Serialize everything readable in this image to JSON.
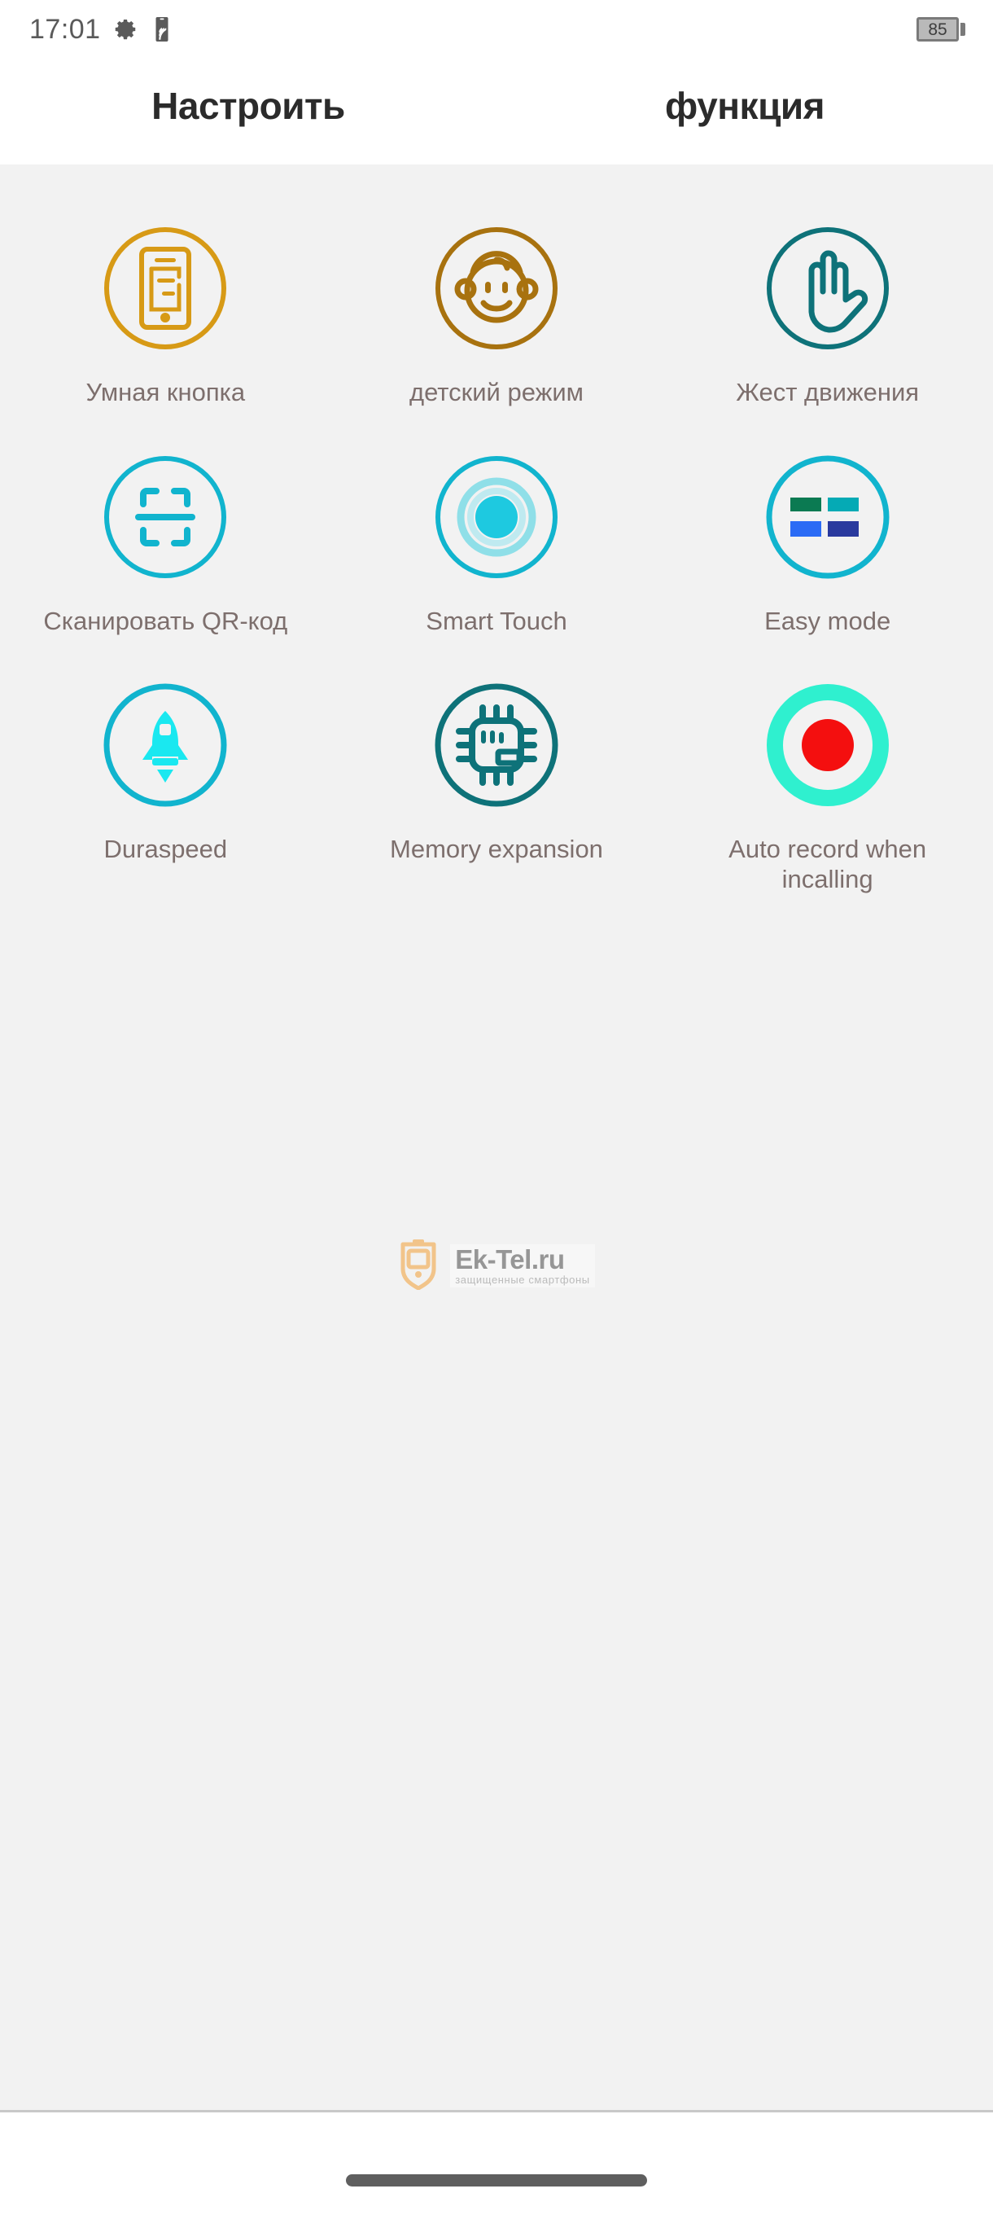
{
  "status_bar": {
    "clock": "17:01",
    "icons": [
      {
        "name": "settings-gear-icon",
        "label": "settings"
      },
      {
        "name": "nfc-tag-icon",
        "label": "nfc"
      }
    ],
    "battery": {
      "level_text": "85"
    }
  },
  "header": {
    "title_left": "Настроить",
    "title_right": "функция"
  },
  "colors": {
    "background": "#f2f2f2",
    "surface": "#ffffff",
    "label_text": "#7d6f6d",
    "header_text": "#2b2b2b",
    "amber": "#d79a16",
    "bronze": "#a8720f",
    "teal_dark": "#0e7279",
    "cyan": "#11b4ce",
    "cyan_bright": "#1ec9e0",
    "cyan_neon": "#1ae8f0",
    "spring_green": "#2ff0cf",
    "record_red": "#f40f0f",
    "easy_green": "#0b7a52",
    "easy_teal": "#05aab5",
    "easy_blue": "#2b6bf5",
    "easy_navy": "#2a3a9e"
  },
  "grid": {
    "tiles": [
      {
        "id": "smart-button",
        "label": "Умная кнопка",
        "icon": "smart-button-icon",
        "color": "#d79a16"
      },
      {
        "id": "child-mode",
        "label": "детский режим",
        "icon": "baby-face-icon",
        "color": "#a8720f"
      },
      {
        "id": "motion-gesture",
        "label": "Жест движения",
        "icon": "hand-gesture-icon",
        "color": "#0e7279"
      },
      {
        "id": "scan-qr",
        "label": "Сканировать QR-код",
        "icon": "qr-scan-icon",
        "color": "#11b4ce"
      },
      {
        "id": "smart-touch",
        "label": "Smart Touch",
        "icon": "smart-touch-icon",
        "color": "#11b4ce"
      },
      {
        "id": "easy-mode",
        "label": "Easy mode",
        "icon": "easy-mode-grid-icon",
        "color": "#11b4ce"
      },
      {
        "id": "duraspeed",
        "label": "Duraspeed",
        "icon": "rocket-icon",
        "color": "#11b4ce"
      },
      {
        "id": "memory-expansion",
        "label": "Memory expansion",
        "icon": "cpu-chip-icon",
        "color": "#0e7279"
      },
      {
        "id": "auto-record",
        "label": "Auto record when incalling",
        "icon": "record-circle-icon",
        "color": "#2ff0cf"
      }
    ]
  },
  "watermark": {
    "title": "Ek-Tel.ru",
    "subtitle": "защищенные смартфоны"
  },
  "nav_bar": {
    "handle": "gesture-handle"
  }
}
